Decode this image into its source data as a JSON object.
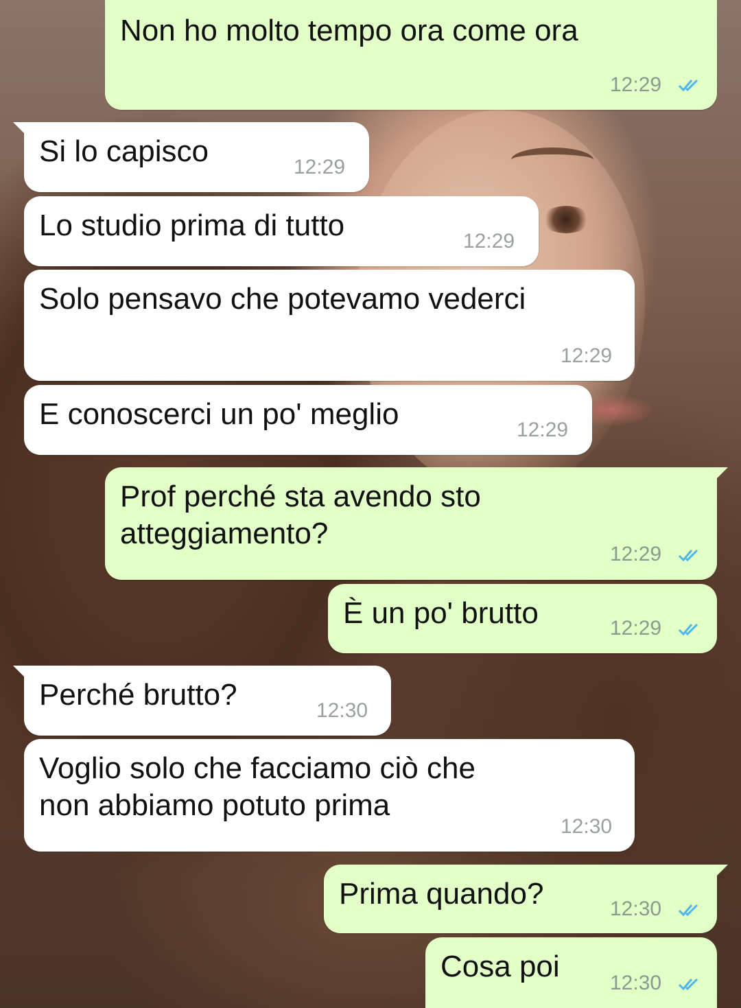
{
  "theme": {
    "outgoing_bubble": "#e1ffc7",
    "incoming_bubble": "#ffffff",
    "read_tick_color": "#4fb6ec"
  },
  "messages": [
    {
      "direction": "outgoing",
      "text": "Non ho molto tempo ora come ora",
      "time": "12:29",
      "status": "read"
    },
    {
      "direction": "incoming",
      "text": "Si lo capisco",
      "time": "12:29"
    },
    {
      "direction": "incoming",
      "text": "Lo studio prima di tutto",
      "time": "12:29"
    },
    {
      "direction": "incoming",
      "text": "Solo pensavo che potevamo vederci",
      "time": "12:29"
    },
    {
      "direction": "incoming",
      "text": "E conoscerci un po' meglio",
      "time": "12:29"
    },
    {
      "direction": "outgoing",
      "text": "Prof perché sta avendo sto\natteggiamento?",
      "time": "12:29",
      "status": "read"
    },
    {
      "direction": "outgoing",
      "text": "È un po' brutto",
      "time": "12:29",
      "status": "read"
    },
    {
      "direction": "incoming",
      "text": "Perché brutto?",
      "time": "12:30"
    },
    {
      "direction": "incoming",
      "text": "Voglio solo che facciamo ciò che\nnon abbiamo potuto prima",
      "time": "12:30"
    },
    {
      "direction": "outgoing",
      "text": "Prima quando?",
      "time": "12:30",
      "status": "read"
    },
    {
      "direction": "outgoing",
      "text": "Cosa poi",
      "time": "12:30",
      "status": "read"
    }
  ]
}
